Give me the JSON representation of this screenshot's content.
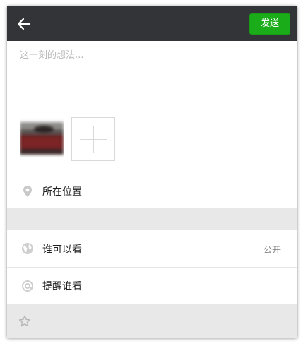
{
  "header": {
    "back_icon": "arrow-left-icon",
    "send_label": "发送",
    "colors": {
      "bar": "#333437",
      "send": "#1aad19"
    }
  },
  "compose": {
    "placeholder": "这一刻的想法...",
    "value": ""
  },
  "media": {
    "thumbnail_icon": "photo-thumbnail",
    "add_icon": "plus-icon"
  },
  "location": {
    "icon": "location-pin-icon",
    "label": "所在位置"
  },
  "visibility": {
    "icon": "globe-icon",
    "label": "谁可以看",
    "value": "公开"
  },
  "mention": {
    "icon": "at-icon",
    "label": "提醒谁看"
  },
  "footer": {
    "icon": "star-icon"
  }
}
